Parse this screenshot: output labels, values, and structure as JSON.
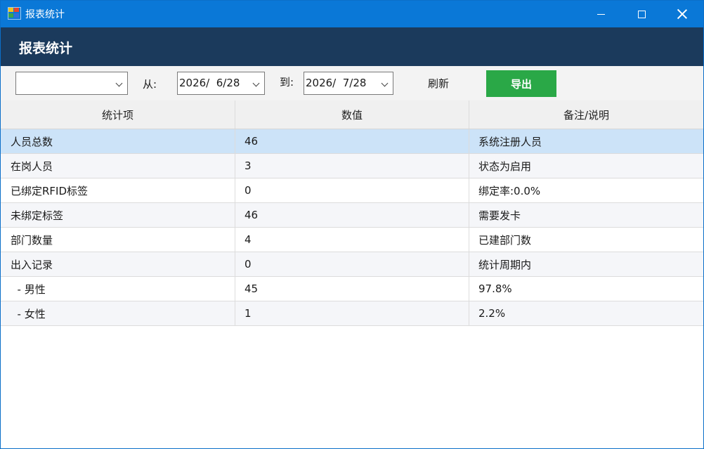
{
  "window": {
    "title": "报表统计"
  },
  "banner": {
    "title": "报表统计"
  },
  "toolbar": {
    "type_select_value": "",
    "from_label": "从:",
    "from_date": "2026/  6/28",
    "to_label": "到:",
    "to_date": "2026/  7/28",
    "refresh_label": "刷新",
    "export_label": "导出"
  },
  "table": {
    "columns": [
      "统计项",
      "数值",
      "备注/说明"
    ],
    "rows": [
      {
        "item": "人员总数",
        "value": "46",
        "note": "系统注册人员"
      },
      {
        "item": "在岗人员",
        "value": "3",
        "note": "状态为启用"
      },
      {
        "item": "已绑定RFID标签",
        "value": "0",
        "note": "绑定率:0.0%"
      },
      {
        "item": "未绑定标签",
        "value": "46",
        "note": "需要发卡"
      },
      {
        "item": "部门数量",
        "value": "4",
        "note": "已建部门数"
      },
      {
        "item": "出入记录",
        "value": "0",
        "note": "统计周期内"
      },
      {
        "item": "  - 男性",
        "value": "45",
        "note": "97.8%"
      },
      {
        "item": "  - 女性",
        "value": "1",
        "note": "2.2%"
      }
    ],
    "selected_row": 0
  },
  "colors": {
    "titlebar": "#0a78d7",
    "banner": "#1b3a5c",
    "export_button": "#2aa847",
    "selected_row": "#cce3f8"
  }
}
